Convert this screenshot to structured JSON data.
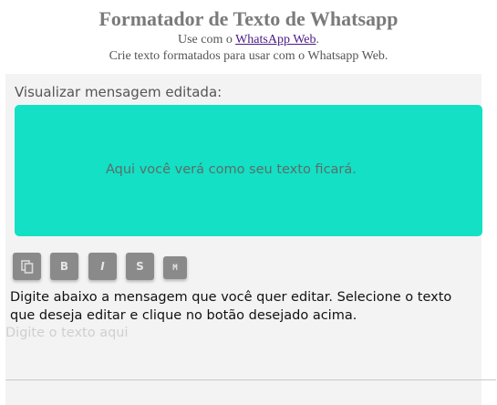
{
  "header": {
    "title": "Formatador de Texto de Whatsapp",
    "subtitle_prefix": "Use com o ",
    "subtitle_link": "WhatsApp Web",
    "subtitle_suffix": ".",
    "description": "Crie texto formatados para usar com o Whatsapp Web."
  },
  "preview": {
    "label": "Visualizar mensagem editada:",
    "placeholder_text": "Aqui você verá como seu texto ficará.",
    "background_color": "#13e0c4"
  },
  "toolbar": {
    "copy_icon": "copy-icon",
    "bold_label": "B",
    "italic_label": "I",
    "strike_label": "S",
    "mono_label": "M"
  },
  "editor": {
    "instructions": "Digite abaixo a mensagem que você quer editar. Selecione o texto que deseja editar e clique no botão desejado acima.",
    "placeholder": "Digite o texto aqui",
    "value": ""
  }
}
